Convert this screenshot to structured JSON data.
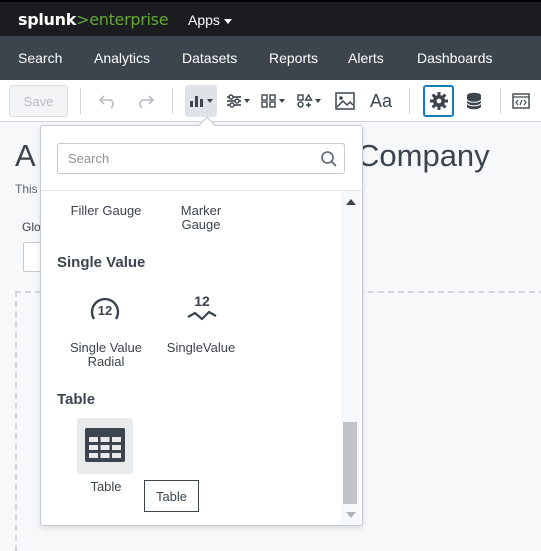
{
  "topbar": {
    "logo_brand": "splunk",
    "logo_gt": ">",
    "logo_product": "enterprise",
    "apps_label": "Apps"
  },
  "appnav": {
    "items": [
      "Search",
      "Analytics",
      "Datasets",
      "Reports",
      "Alerts",
      "Dashboards"
    ]
  },
  "toolbar": {
    "save_label": "Save",
    "text_button_label": "Aa"
  },
  "page": {
    "title_left": "A",
    "title_right": "Company",
    "description": "This",
    "global_label": "Glo"
  },
  "viz_picker": {
    "search_placeholder": "Search",
    "gauges": [
      {
        "label": "Filler Gauge"
      },
      {
        "label": "Marker\nGauge"
      }
    ],
    "single_value_heading": "Single Value",
    "single_value_items": [
      {
        "label": "Single Value\nRadial",
        "icon": "single-value-radial-icon",
        "icon_text": "12"
      },
      {
        "label": "SingleValue",
        "icon": "single-value-icon",
        "icon_text": "12"
      }
    ],
    "table_heading": "Table",
    "table_item": {
      "label": "Table",
      "icon": "table-grid-icon"
    },
    "tooltip": "Table"
  },
  "colors": {
    "topbar_bg": "#1a1c20",
    "appnav_bg": "#3c444d",
    "brand_green": "#65a637",
    "accent_blue": "#1a7ab6",
    "text_dark": "#3c444d"
  }
}
